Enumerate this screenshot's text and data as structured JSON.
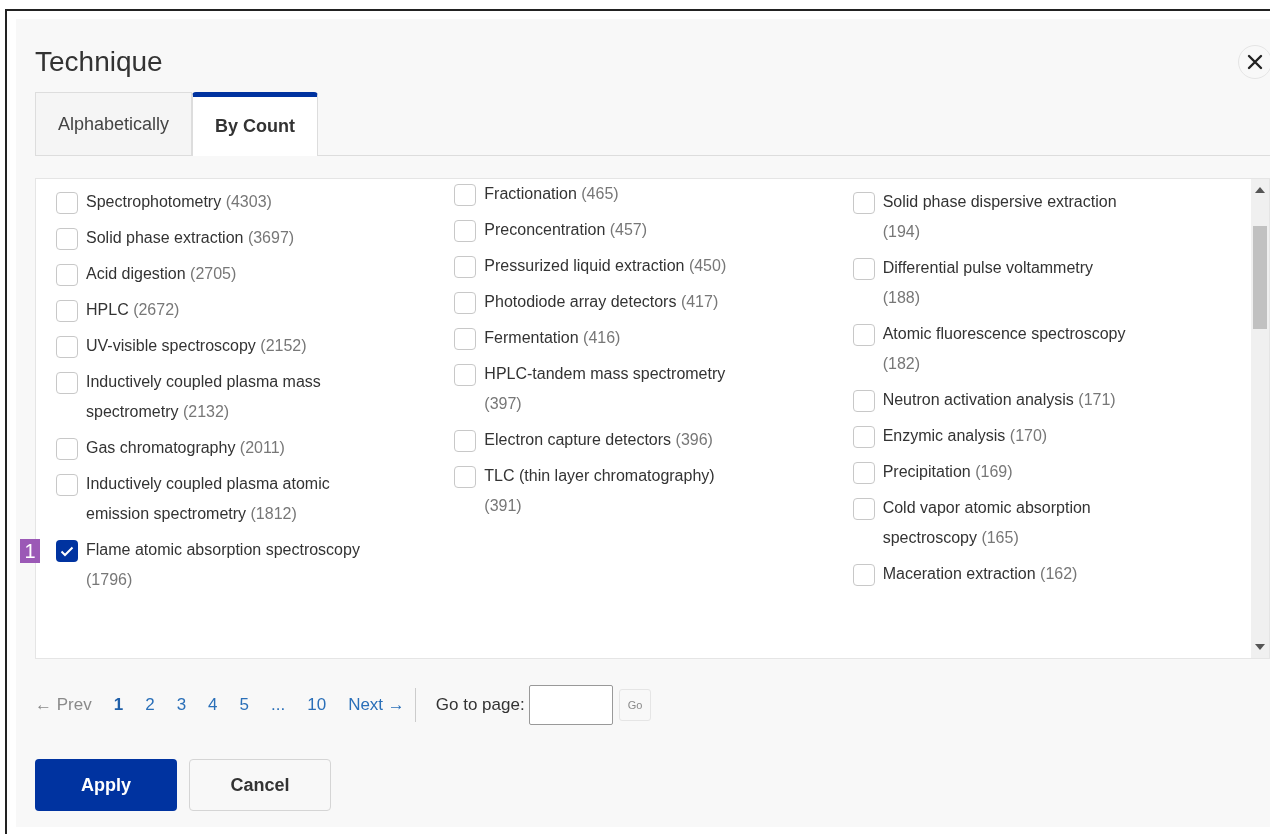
{
  "dialog": {
    "title": "Technique"
  },
  "tabs": [
    {
      "label": "Alphabetically",
      "selected": false
    },
    {
      "label": "By Count",
      "selected": true
    }
  ],
  "columns": [
    {
      "items": [
        {
          "name": "Spectrophotometry",
          "count": "(4303)",
          "checked": false
        },
        {
          "name": "Solid phase extraction",
          "count": "(3697)",
          "checked": false
        },
        {
          "name": "Acid digestion",
          "count": "(2705)",
          "checked": false
        },
        {
          "name": "HPLC",
          "count": "(2672)",
          "checked": false
        },
        {
          "name": "UV-visible spectroscopy",
          "count": "(2152)",
          "checked": false
        },
        {
          "name": "Inductively coupled plasma mass spectrometry",
          "count": "(2132)",
          "checked": false
        },
        {
          "name": "Gas chromatography",
          "count": "(2011)",
          "checked": false
        },
        {
          "name": "Inductively coupled plasma atomic emission spectrometry",
          "count": "(1812)",
          "checked": false
        },
        {
          "name": "Flame atomic absorption spectroscopy",
          "count": "(1796)",
          "checked": true,
          "badge": "1"
        }
      ]
    },
    {
      "items": [
        {
          "name": "Fractionation",
          "count": "(465)",
          "checked": false
        },
        {
          "name": "Preconcentration",
          "count": "(457)",
          "checked": false
        },
        {
          "name": "Pressurized liquid extraction",
          "count": "(450)",
          "checked": false
        },
        {
          "name": "Photodiode array detectors",
          "count": "(417)",
          "checked": false
        },
        {
          "name": "Fermentation",
          "count": "(416)",
          "checked": false
        },
        {
          "name": "HPLC-tandem mass spectrometry",
          "count": "(397)",
          "checked": false
        },
        {
          "name": "Electron capture detectors",
          "count": "(396)",
          "checked": false
        },
        {
          "name": "TLC (thin layer chromatography)",
          "count": "(391)",
          "checked": false
        }
      ]
    },
    {
      "items": [
        {
          "name": "Solid phase dispersive extraction",
          "count": "(194)",
          "checked": false
        },
        {
          "name": "Differential pulse voltammetry",
          "count": "(188)",
          "checked": false
        },
        {
          "name": "Atomic fluorescence spectroscopy",
          "count": "(182)",
          "checked": false
        },
        {
          "name": "Neutron activation analysis",
          "count": "(171)",
          "checked": false
        },
        {
          "name": "Enzymic analysis",
          "count": "(170)",
          "checked": false
        },
        {
          "name": "Precipitation",
          "count": "(169)",
          "checked": false
        },
        {
          "name": "Cold vapor atomic absorption spectroscopy",
          "count": "(165)",
          "checked": false
        },
        {
          "name": "Maceration extraction",
          "count": "(162)",
          "checked": false
        }
      ]
    }
  ],
  "pagination": {
    "prev": {
      "label": "← Prev",
      "disabled": true
    },
    "pages": [
      {
        "label": "1",
        "selected": true
      },
      {
        "label": "2",
        "selected": false
      },
      {
        "label": "3",
        "selected": false
      },
      {
        "label": "4",
        "selected": false
      },
      {
        "label": "5",
        "selected": false
      },
      {
        "label": "...",
        "selected": false
      },
      {
        "label": "10",
        "selected": false
      }
    ],
    "next": {
      "label": "Next →",
      "disabled": false
    },
    "goto_label": "Go to page:",
    "go_button": {
      "label": "Go",
      "disabled": true
    }
  },
  "buttons": [
    {
      "label": "Apply",
      "kind": "primary"
    },
    {
      "label": "Cancel",
      "kind": "secondary"
    }
  ]
}
